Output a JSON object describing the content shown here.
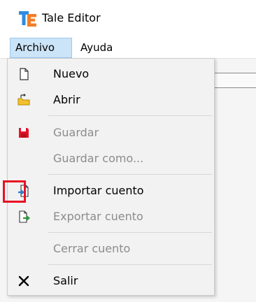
{
  "window": {
    "title": "Tale Editor",
    "logo_icon": "tale-editor-logo-icon"
  },
  "menubar": {
    "items": [
      {
        "label": "Archivo",
        "state": "open"
      },
      {
        "label": "Ayuda"
      }
    ]
  },
  "archivo_menu": {
    "items": [
      {
        "label": "Nuevo",
        "icon": "new-file-icon",
        "enabled": true
      },
      {
        "label": "Abrir",
        "icon": "open-folder-icon",
        "enabled": true
      },
      {
        "label": "Guardar",
        "icon": "save-icon",
        "enabled": false
      },
      {
        "label": "Guardar como...",
        "icon": null,
        "enabled": false
      },
      {
        "label": "Importar cuento",
        "icon": "import-icon",
        "enabled": true,
        "highlighted": true
      },
      {
        "label": "Exportar cuento",
        "icon": "export-icon",
        "enabled": false
      },
      {
        "label": "Cerrar cuento",
        "icon": null,
        "enabled": false
      },
      {
        "label": "Salir",
        "icon": "close-x-icon",
        "enabled": true
      }
    ]
  },
  "colors": {
    "menu_open_bg": "#cce4f7",
    "menu_open_border": "#99c9ef",
    "disabled_text": "#8c8c8c",
    "highlight_border": "#e81123",
    "save_icon": "#e3152b",
    "import_export_icon": "#2e9a3d",
    "open_icon": "#f2c12e"
  }
}
